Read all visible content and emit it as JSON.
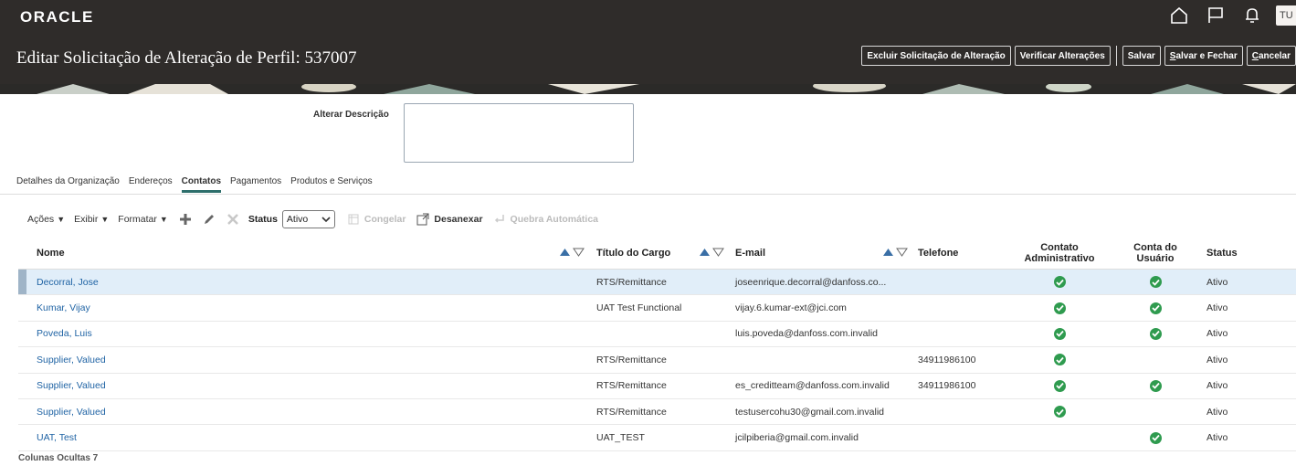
{
  "header": {
    "logo": "ORACLE",
    "user_initials": "TU",
    "page_title": "Editar Solicitação de Alteração de Perfil: 537007",
    "buttons": {
      "delete_request": "Excluir Solicitação de Alteração",
      "review_changes": "Verificar Alterações",
      "save": "Salvar",
      "save_close": "Salvar e Fechar",
      "cancel": "Cancelar"
    },
    "icons": [
      "home-icon",
      "flag-icon",
      "bell-icon"
    ]
  },
  "description": {
    "label": "Alterar Descrição",
    "value": ""
  },
  "tabs": [
    {
      "label": "Detalhes da Organização",
      "active": false
    },
    {
      "label": "Endereços",
      "active": false
    },
    {
      "label": "Contatos",
      "active": true
    },
    {
      "label": "Pagamentos",
      "active": false
    },
    {
      "label": "Produtos e Serviços",
      "active": false
    }
  ],
  "toolbar": {
    "actions": "Ações",
    "view": "Exibir",
    "format": "Formatar",
    "status_label": "Status",
    "status_value": "Ativo",
    "freeze": "Congelar",
    "detach": "Desanexar",
    "wrap": "Quebra Automática"
  },
  "table": {
    "columns": {
      "name": "Nome",
      "title": "Título do Cargo",
      "email": "E-mail",
      "phone": "Telefone",
      "admin_contact_1": "Contato",
      "admin_contact_2": "Administrativo",
      "user_account_1": "Conta do",
      "user_account_2": "Usuário",
      "status": "Status"
    },
    "rows": [
      {
        "name": "Decorral, Jose",
        "title": "RTS/Remittance",
        "email": "joseenrique.decorral@danfoss.co...",
        "phone": "",
        "admin": true,
        "user": true,
        "status": "Ativo",
        "selected": true
      },
      {
        "name": "Kumar, Vijay",
        "title": "UAT Test Functional",
        "email": "vijay.6.kumar-ext@jci.com",
        "phone": "",
        "admin": true,
        "user": true,
        "status": "Ativo",
        "selected": false
      },
      {
        "name": "Poveda, Luis",
        "title": "",
        "email": "luis.poveda@danfoss.com.invalid",
        "phone": "",
        "admin": true,
        "user": true,
        "status": "Ativo",
        "selected": false
      },
      {
        "name": "Supplier, Valued",
        "title": "RTS/Remittance",
        "email": "",
        "phone": "34911986100",
        "admin": true,
        "user": false,
        "status": "Ativo",
        "selected": false
      },
      {
        "name": "Supplier, Valued",
        "title": "RTS/Remittance",
        "email": "es_creditteam@danfoss.com.invalid",
        "phone": "34911986100",
        "admin": true,
        "user": true,
        "status": "Ativo",
        "selected": false
      },
      {
        "name": "Supplier, Valued",
        "title": "RTS/Remittance",
        "email": "testusercohu30@gmail.com.invalid",
        "phone": "",
        "admin": true,
        "user": false,
        "status": "Ativo",
        "selected": false
      },
      {
        "name": "UAT, Test",
        "title": "UAT_TEST",
        "email": "jcilpiberia@gmail.com.invalid",
        "phone": "",
        "admin": false,
        "user": true,
        "status": "Ativo",
        "selected": false
      }
    ]
  },
  "footer": {
    "hidden_columns": "Colunas Ocultas  7"
  },
  "colors": {
    "header_bg": "#2f2c2a",
    "link": "#1f63a4",
    "check": "#2f9b4f",
    "selected_row": "#e1eef9",
    "sort_arrow": "#3a6fa6"
  }
}
